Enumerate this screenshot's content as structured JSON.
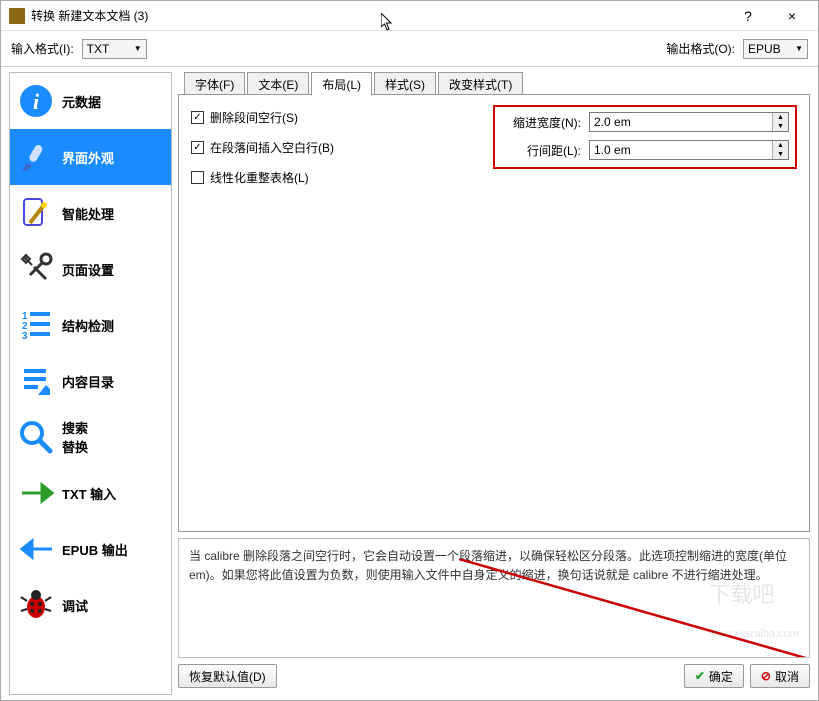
{
  "title": "转换 新建文本文档 (3)",
  "titlebar_help": "?",
  "titlebar_close": "×",
  "input_format_label": "输入格式(I):",
  "input_format_value": "TXT",
  "output_format_label": "输出格式(O):",
  "output_format_value": "EPUB",
  "sidebar": [
    {
      "label": "元数据"
    },
    {
      "label": "界面外观"
    },
    {
      "label": "智能处理"
    },
    {
      "label": "页面设置"
    },
    {
      "label": "结构检测"
    },
    {
      "label": "内容目录"
    },
    {
      "label": "搜索\n替换"
    },
    {
      "label": "TXT 输入"
    },
    {
      "label": "EPUB 输出"
    },
    {
      "label": "调试"
    }
  ],
  "tabs": [
    {
      "label": "字体(F)"
    },
    {
      "label": "文本(E)"
    },
    {
      "label": "布局(L)"
    },
    {
      "label": "样式(S)"
    },
    {
      "label": "改变样式(T)"
    }
  ],
  "checkboxes": {
    "remove_blank": "删除段间空行(S)",
    "insert_blank": "在段落间插入空白行(B)",
    "linearize": "线性化重整表格(L)"
  },
  "fields": {
    "indent_label": "缩进宽度(N):",
    "indent_value": "2.0 em",
    "linespacing_label": "行间距(L):",
    "linespacing_value": "1.0 em"
  },
  "help_text": "当 calibre 删除段落之间空行时，它会自动设置一个段落缩进，以确保轻松区分段落。此选项控制缩进的宽度(单位 em)。如果您将此值设置为负数，则使用输入文件中自身定义的缩进，换句话说就是 calibre 不进行缩进处理。",
  "buttons": {
    "restore": "恢复默认值(D)",
    "ok": "确定",
    "cancel": "取消"
  }
}
